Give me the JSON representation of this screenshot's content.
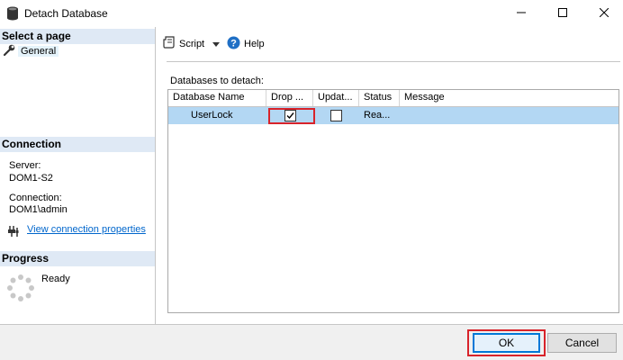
{
  "window": {
    "title": "Detach Database",
    "title_icon": "database-icon"
  },
  "sidebar": {
    "select_page_header": "Select a page",
    "pages": [
      {
        "label": "General",
        "icon": "wrench-icon"
      }
    ],
    "connection": {
      "header": "Connection",
      "server_label": "Server:",
      "server_value": "DOM1-S2",
      "connection_label": "Connection:",
      "connection_value": "DOM1\\admin",
      "view_link": "View connection properties"
    },
    "progress": {
      "header": "Progress",
      "status": "Ready"
    }
  },
  "toolbar": {
    "script_label": "Script",
    "help_label": "Help"
  },
  "main": {
    "grid_label": "Databases to detach:",
    "columns": [
      "Database Name",
      "Drop ...",
      "Updat...",
      "Status",
      "Message"
    ],
    "rows": [
      {
        "database_name": "UserLock",
        "drop_connections": true,
        "update_statistics": false,
        "status": "Rea...",
        "message": ""
      }
    ]
  },
  "footer": {
    "ok_label": "OK",
    "cancel_label": "Cancel"
  },
  "colors": {
    "selected_row": "#b3d7f3",
    "section_header": "#dfe9f5",
    "highlight_frame": "#d8232a",
    "link": "#0066cc"
  }
}
